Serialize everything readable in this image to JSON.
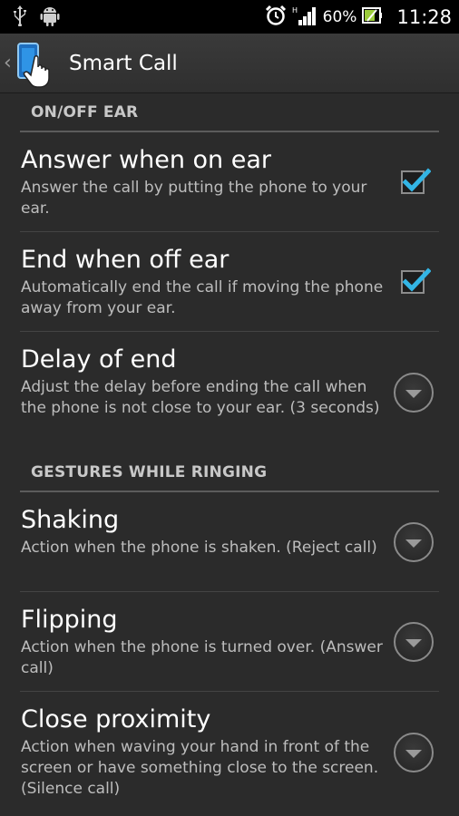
{
  "status_bar": {
    "battery_text": "60%",
    "time": "11:28",
    "icons": [
      "usb-icon",
      "android-debug-icon",
      "alarm-clock-icon",
      "signal-icon",
      "battery-icon"
    ]
  },
  "action_bar": {
    "title": "Smart Call",
    "icons": [
      "back-chevron-icon",
      "app-phone-hand-icon"
    ]
  },
  "sections": [
    {
      "header": "ON/OFF EAR",
      "prefs": [
        {
          "title": "Answer when on ear",
          "summary": "Answer the call by putting the phone to your ear.",
          "widget": "checkbox",
          "checked": true
        },
        {
          "title": "End when off ear",
          "summary": "Automatically end the call if moving the phone away from your ear.",
          "widget": "checkbox",
          "checked": true
        },
        {
          "title": "Delay of end",
          "summary": "Adjust the delay before ending the call when the phone is not close to your ear. (3 seconds)",
          "widget": "dropdown"
        }
      ]
    },
    {
      "header": "GESTURES WHILE RINGING",
      "prefs": [
        {
          "title": "Shaking",
          "summary": "Action when the phone is shaken. (Reject call)",
          "widget": "dropdown"
        },
        {
          "title": "Flipping",
          "summary": "Action when the phone is turned over. (Answer call)",
          "widget": "dropdown"
        },
        {
          "title": "Close proximity",
          "summary": "Action when waving your hand in front of the screen or have something close to the screen. (Silence call)",
          "widget": "dropdown"
        }
      ]
    }
  ],
  "colors": {
    "accent": "#33b5e5",
    "background": "#2b2b2b",
    "status_bar": "#000000"
  }
}
